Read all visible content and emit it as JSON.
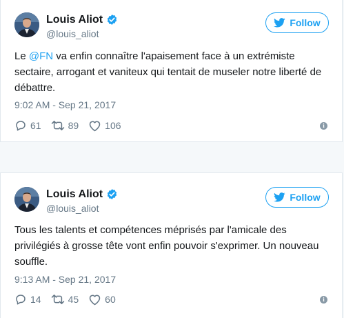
{
  "colors": {
    "accent": "#1da1f2",
    "muted": "#657786",
    "text": "#14171a"
  },
  "tweets": [
    {
      "author": {
        "name": "Louis Aliot",
        "handle": "@louis_aliot",
        "verified": true
      },
      "follow_label": "Follow",
      "text_before_mention": "Le ",
      "mention": "@FN",
      "text_after_mention": " va enfin connaître l'apaisement face à un extrémiste sectaire, arrogant et vaniteux qui tentait de museler notre liberté de débattre.",
      "timestamp": "9:02 AM - Sep 21, 2017",
      "replies": "61",
      "retweets": "89",
      "likes": "106"
    },
    {
      "author": {
        "name": "Louis Aliot",
        "handle": "@louis_aliot",
        "verified": true
      },
      "follow_label": "Follow",
      "text": "Tous les talents et compétences méprisés par l'amicale des privilégiés à grosse tête vont enfin pouvoir s'exprimer. Un nouveau souffle.",
      "timestamp": "9:13 AM - Sep 21, 2017",
      "replies": "14",
      "retweets": "45",
      "likes": "60"
    }
  ],
  "icons": [
    "verified-badge-icon",
    "twitter-bird-icon",
    "reply-icon",
    "retweet-icon",
    "like-heart-icon",
    "info-icon"
  ]
}
